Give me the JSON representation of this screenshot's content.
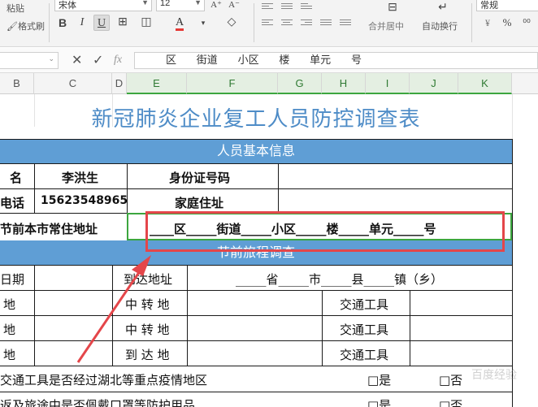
{
  "ribbon": {
    "font_name": "宋体",
    "font_size": "12",
    "number_format": "常规",
    "format_painter_label": "格式刷",
    "paste_label": "粘贴",
    "merge_label": "合并居中",
    "wrap_label": "自动换行",
    "bold": "B",
    "italic": "I",
    "underline": "U",
    "font_color_glyph": "A",
    "percent_glyph": "%",
    "currency_glyph": "¥"
  },
  "formula_bar": {
    "name_box_value": "",
    "cancel_glyph": "✕",
    "confirm_glyph": "✓",
    "fx_glyph": "fx",
    "content": "区      街道      小区      楼      单元      号"
  },
  "columns": [
    "B",
    "C",
    "D",
    "E",
    "F",
    "G",
    "H",
    "I",
    "J",
    "K"
  ],
  "sheet": {
    "title": "新冠肺炎企业复工人员防控调查表",
    "section_basic": "人员基本信息",
    "name_label": "名",
    "name_value": "李洪生",
    "id_label": "身份证号码",
    "phone_label": "电话",
    "phone_value": "15623548965",
    "home_label": "家庭住址",
    "residence_label": "节前本市常住地址",
    "address_template": "____区_____街道_____小区_____楼_____单元_____号",
    "section_travel": "节前旅程调查",
    "date_label": "日期",
    "arrive_addr_label": "到达地址",
    "province_template": "_____省_____市_____县_____镇（乡）",
    "depart_label": "地",
    "transit_label": "中 转 地",
    "arrive_label": "到 达 地",
    "transport_label": "交通工具",
    "q1": "交通工具是否经过湖北等重点疫情地区",
    "q2": "返及旅途中是否佩戴口罩等防护用品",
    "yes": "□是",
    "no": "□否"
  },
  "watermark": "百度经验",
  "colors": {
    "accent_green": "#3ca63f",
    "band_blue": "#5f9ed5",
    "title_blue": "#4e8cc7",
    "annotation_red": "#e4464a"
  }
}
